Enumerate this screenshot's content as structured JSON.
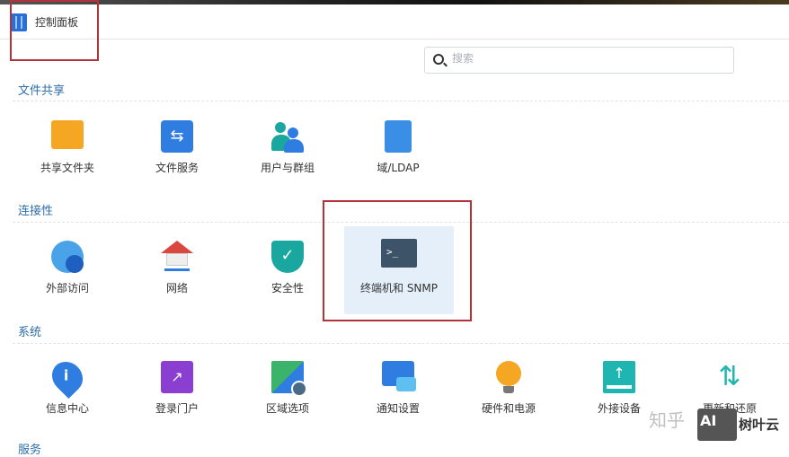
{
  "header": {
    "title": "控制面板"
  },
  "search": {
    "placeholder": "搜索"
  },
  "sections": [
    {
      "title": "文件共享",
      "items": [
        {
          "label": "共享文件夹",
          "icon": "folder-icon"
        },
        {
          "label": "文件服务",
          "icon": "file-services-icon"
        },
        {
          "label": "用户与群组",
          "icon": "users-icon"
        },
        {
          "label": "域/LDAP",
          "icon": "ldap-icon"
        }
      ]
    },
    {
      "title": "连接性",
      "items": [
        {
          "label": "外部访问",
          "icon": "external-access-icon"
        },
        {
          "label": "网络",
          "icon": "network-icon"
        },
        {
          "label": "安全性",
          "icon": "shield-icon"
        },
        {
          "label": "终端机和 SNMP",
          "icon": "terminal-icon"
        }
      ]
    },
    {
      "title": "系统",
      "items": [
        {
          "label": "信息中心",
          "icon": "info-icon"
        },
        {
          "label": "登录门户",
          "icon": "login-portal-icon"
        },
        {
          "label": "区域选项",
          "icon": "regional-icon"
        },
        {
          "label": "通知设置",
          "icon": "notification-icon"
        },
        {
          "label": "硬件和电源",
          "icon": "bulb-icon"
        },
        {
          "label": "外接设备",
          "icon": "external-device-icon"
        },
        {
          "label": "更新和还原",
          "icon": "update-icon"
        }
      ]
    },
    {
      "title": "服务",
      "items": []
    }
  ],
  "watermark": {
    "text": "知乎",
    "badge": "AI",
    "brand": "树叶云"
  }
}
